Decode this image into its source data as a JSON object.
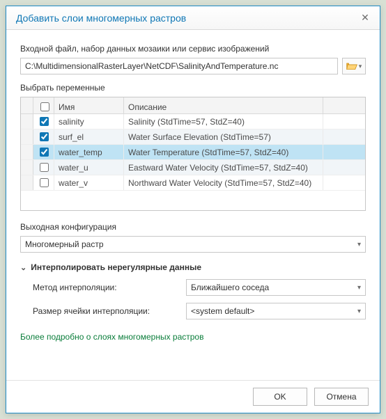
{
  "dialog": {
    "title": "Добавить слои многомерных растров",
    "close_icon": "✕"
  },
  "input_section": {
    "label": "Входной файл, набор данных мозаики или сервис изображений",
    "path": "C:\\MultidimensionalRasterLayer\\NetCDF\\SalinityAndTemperature.nc"
  },
  "variables": {
    "label": "Выбрать переменные",
    "headers": {
      "name": "Имя",
      "desc": "Описание"
    },
    "rows": [
      {
        "checked": true,
        "name": "salinity",
        "desc": "Salinity (StdTime=57, StdZ=40)"
      },
      {
        "checked": true,
        "name": "surf_el",
        "desc": "Water Surface Elevation (StdTime=57)"
      },
      {
        "checked": true,
        "name": "water_temp",
        "desc": "Water Temperature (StdTime=57, StdZ=40)"
      },
      {
        "checked": false,
        "name": "water_u",
        "desc": "Eastward Water Velocity (StdTime=57, StdZ=40)"
      },
      {
        "checked": false,
        "name": "water_v",
        "desc": "Northward Water Velocity (StdTime=57, StdZ=40)"
      }
    ],
    "selected_index": 2
  },
  "output_config": {
    "label": "Выходная конфигурация",
    "value": "Многомерный растр"
  },
  "interp": {
    "section_title": "Интерполировать нерегулярные данные",
    "method_label": "Метод интерполяции:",
    "method_value": "Ближайшего соседа",
    "cell_label": "Размер ячейки интерполяции:",
    "cell_value": "<system default>"
  },
  "link": {
    "text": "Более подробно о слоях многомерных растров"
  },
  "footer": {
    "ok": "OK",
    "cancel": "Отмена"
  }
}
